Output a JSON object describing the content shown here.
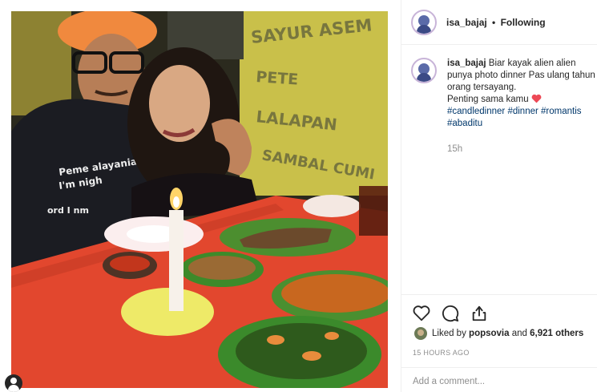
{
  "post": {
    "username": "isa_bajaj",
    "separator": "•",
    "follow_status": "Following",
    "caption": {
      "username": "isa_bajaj",
      "text": "Biar kayak alien alien punya photo dinner Pas ulang tahun orang tersayang.",
      "line2": "Penting sama kamu",
      "hashtags": "#candledinner #dinner #romantis #abaditu"
    },
    "time_short": "15h",
    "likes": {
      "prefix": "Liked by",
      "user": "popsovia",
      "middle": "and",
      "count": "6,921 others"
    },
    "time_long": "15 HOURS AGO",
    "comment_placeholder": "Add a comment..."
  },
  "photo": {
    "sign_text_1": "SAYUR ASEM",
    "sign_text_2": "PETE",
    "sign_text_3": "LALAPAN",
    "sign_text_4": "SAMBAL CUMI",
    "shirt_text_1": "Peme alayania",
    "shirt_text_2": "I'm nigh",
    "shirt_text_3": "ord I nm"
  },
  "colors": {
    "heart": "#ed4956",
    "hashtag": "#00376b",
    "secondary": "#8e8e8e",
    "border": "#efefef"
  },
  "icons": [
    "heart-icon",
    "comment-icon",
    "share-icon"
  ]
}
